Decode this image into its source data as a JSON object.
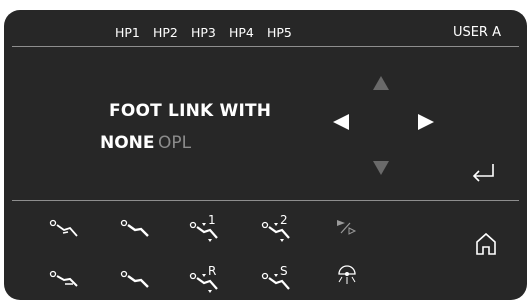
{
  "header": {
    "hp_tabs": [
      {
        "label": "HP1"
      },
      {
        "label": "HP2"
      },
      {
        "label": "HP3"
      },
      {
        "label": "HP4"
      },
      {
        "label": "HP5"
      }
    ],
    "user_label": "USER A"
  },
  "main": {
    "title": "FOOT LINK WITH",
    "options": [
      {
        "label": "NONE",
        "selected": true,
        "color": "#ffffff"
      },
      {
        "label": "OPL",
        "selected": false,
        "color": "#8c8c8c"
      }
    ]
  },
  "colors": {
    "panel_bg": "#272727",
    "text": "#ffffff",
    "dim": "#8c8c8c",
    "rule": "#8e8e8e"
  },
  "icons": {
    "row1": [
      {
        "name": "chair-position-1-icon",
        "label": ""
      },
      {
        "name": "chair-position-2-icon",
        "label": ""
      },
      {
        "name": "memory-1-icon",
        "label": "1"
      },
      {
        "name": "memory-2-icon",
        "label": "2"
      },
      {
        "name": "play-step-icon",
        "label": ""
      }
    ],
    "row2": [
      {
        "name": "chair-up-position-icon",
        "label": ""
      },
      {
        "name": "chair-down-position-icon",
        "label": ""
      },
      {
        "name": "memory-r-icon",
        "label": "R"
      },
      {
        "name": "memory-s-icon",
        "label": "S"
      },
      {
        "name": "operating-light-icon",
        "label": ""
      }
    ],
    "home": "home-icon",
    "enter": "enter-icon"
  }
}
